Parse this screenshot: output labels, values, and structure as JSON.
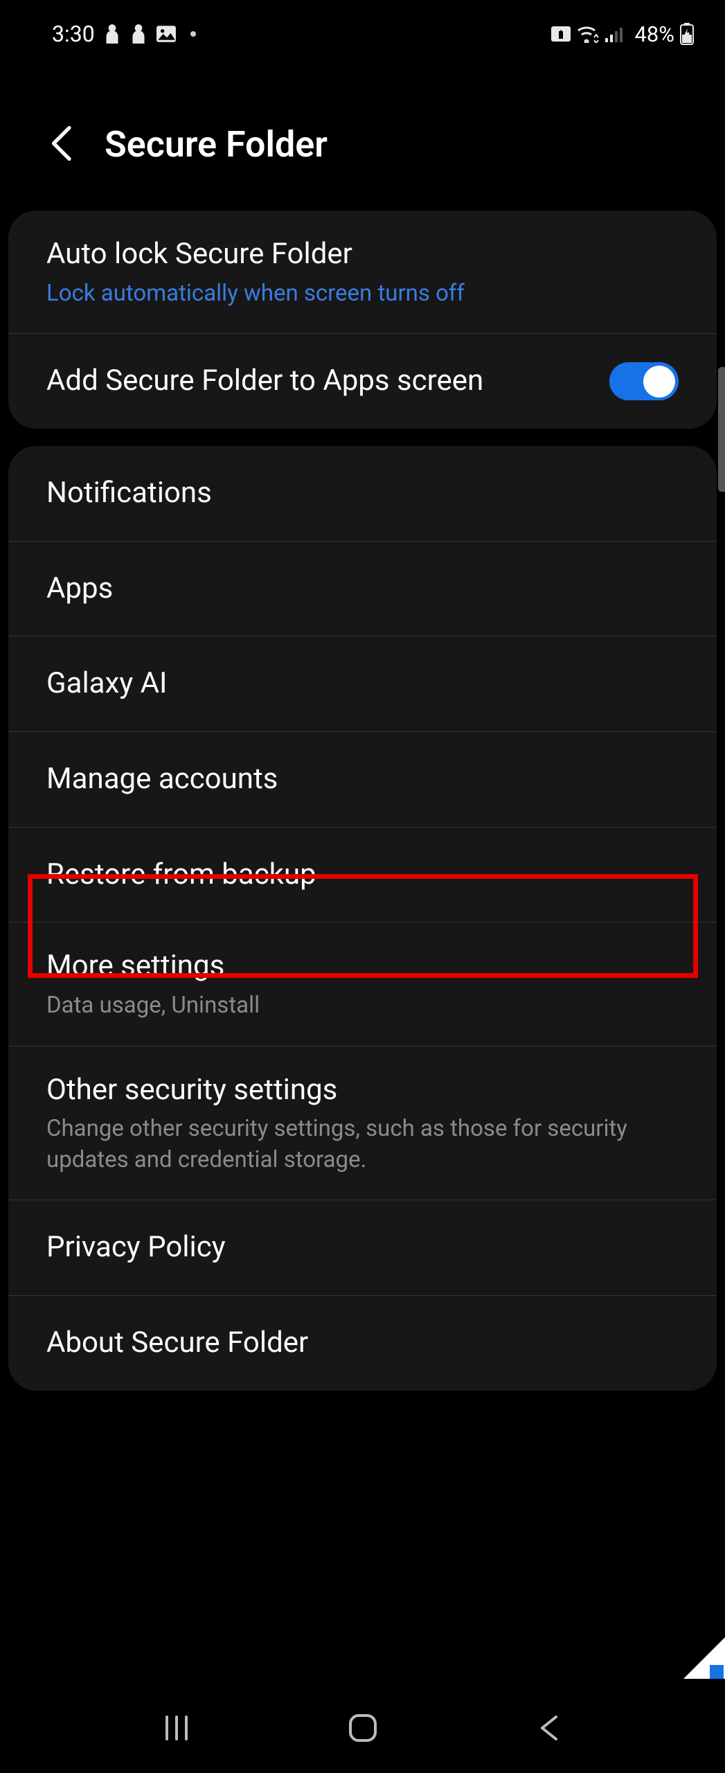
{
  "status": {
    "time": "3:30",
    "battery": "48%"
  },
  "header": {
    "title": "Secure Folder"
  },
  "section1": {
    "autolock": {
      "title": "Auto lock Secure Folder",
      "subtitle": "Lock automatically when screen turns off"
    },
    "addToApps": {
      "title": "Add Secure Folder to Apps screen"
    }
  },
  "section2": {
    "notifications": {
      "title": "Notifications"
    },
    "apps": {
      "title": "Apps"
    },
    "galaxyai": {
      "title": "Galaxy AI"
    },
    "manageAccounts": {
      "title": "Manage accounts"
    },
    "restoreBackup": {
      "title": "Restore from backup"
    },
    "moreSettings": {
      "title": "More settings",
      "subtitle": "Data usage, Uninstall"
    },
    "otherSecurity": {
      "title": "Other security settings",
      "subtitle": "Change other security settings, such as those for security updates and credential storage."
    },
    "privacyPolicy": {
      "title": "Privacy Policy"
    },
    "about": {
      "title": "About Secure Folder"
    }
  }
}
